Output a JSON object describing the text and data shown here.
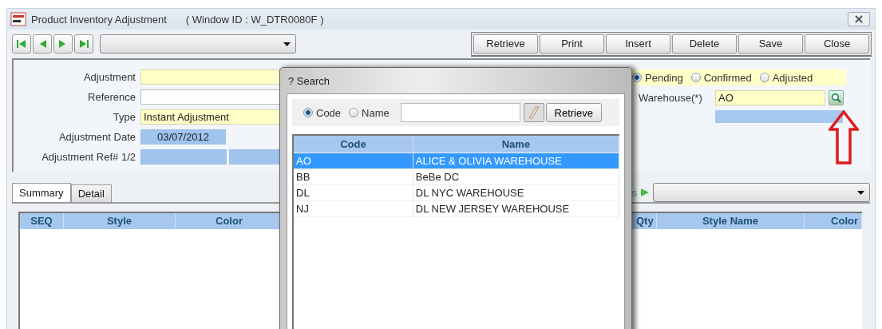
{
  "window": {
    "title": "Product Inventory Adjustment",
    "window_id": "( Window ID : W_DTR0080F )"
  },
  "toolbar": {
    "buttons": [
      "Retrieve",
      "Print",
      "Insert",
      "Delete",
      "Save",
      "Close"
    ]
  },
  "form": {
    "fields": [
      {
        "label": "Adjustment",
        "kind": "yellow"
      },
      {
        "label": "Reference",
        "kind": "white"
      },
      {
        "label": "Type",
        "kind": "yellow",
        "value": "Instant Adjustment"
      },
      {
        "label": "Adjustment Date",
        "kind": "date",
        "value": "03/07/2012"
      },
      {
        "label": "Adjustment Ref# 1/2",
        "kind": "pair"
      }
    ],
    "status_options": [
      {
        "label": "Pending",
        "selected": true
      },
      {
        "label": "Confirmed",
        "selected": false
      },
      {
        "label": "Adjusted",
        "selected": false
      }
    ],
    "warehouse": {
      "label": "Warehouse(*)",
      "value": "AO"
    }
  },
  "tabs": [
    {
      "label": "Summary",
      "selected": true
    },
    {
      "label": "Detail",
      "selected": false
    }
  ],
  "tab_bar_label": "s",
  "grid": {
    "left_columns": [
      "SEQ",
      "Style",
      "Color"
    ],
    "right_columns": [
      "Qty",
      "Style Name",
      "Color"
    ]
  },
  "search_dialog": {
    "title": "? Search",
    "search_by": [
      {
        "label": "Code",
        "selected": true
      },
      {
        "label": "Name",
        "selected": false
      }
    ],
    "retrieve": "Retrieve",
    "columns": [
      "Code",
      "Name"
    ],
    "rows": [
      {
        "code": "AO",
        "name": "ALICE & OLIVIA WAREHOUSE",
        "selected": true
      },
      {
        "code": "BB",
        "name": "BeBe DC",
        "selected": false
      },
      {
        "code": "DL",
        "name": "DL NYC WAREHOUSE",
        "selected": false
      },
      {
        "code": "NJ",
        "name": "DL NEW JERSEY WAREHOUSE",
        "selected": false
      }
    ]
  }
}
